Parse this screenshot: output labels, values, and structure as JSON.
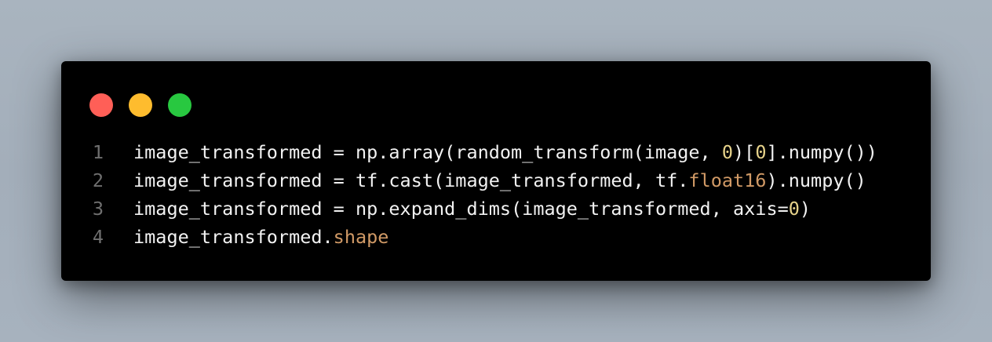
{
  "window": {
    "controls": [
      {
        "name": "close",
        "color": "#ff5f57"
      },
      {
        "name": "minimize",
        "color": "#febc2e"
      },
      {
        "name": "maximize",
        "color": "#28c840"
      }
    ]
  },
  "code": {
    "lines": [
      {
        "number": "1",
        "tokens": [
          {
            "text": "image_transformed = np.array(random_transform(image, ",
            "kind": "plain"
          },
          {
            "text": "0",
            "kind": "number"
          },
          {
            "text": ")[",
            "kind": "plain"
          },
          {
            "text": "0",
            "kind": "number"
          },
          {
            "text": "].numpy())",
            "kind": "plain"
          }
        ]
      },
      {
        "number": "2",
        "tokens": [
          {
            "text": "image_transformed = tf.cast(image_transformed, tf.",
            "kind": "plain"
          },
          {
            "text": "float16",
            "kind": "attribute"
          },
          {
            "text": ").numpy()",
            "kind": "plain"
          }
        ]
      },
      {
        "number": "3",
        "tokens": [
          {
            "text": "image_transformed = np.expand_dims(image_transformed, axis=",
            "kind": "plain"
          },
          {
            "text": "0",
            "kind": "number"
          },
          {
            "text": ")",
            "kind": "plain"
          }
        ]
      },
      {
        "number": "4",
        "tokens": [
          {
            "text": "image_transformed.",
            "kind": "plain"
          },
          {
            "text": "shape",
            "kind": "attribute"
          }
        ]
      }
    ]
  }
}
